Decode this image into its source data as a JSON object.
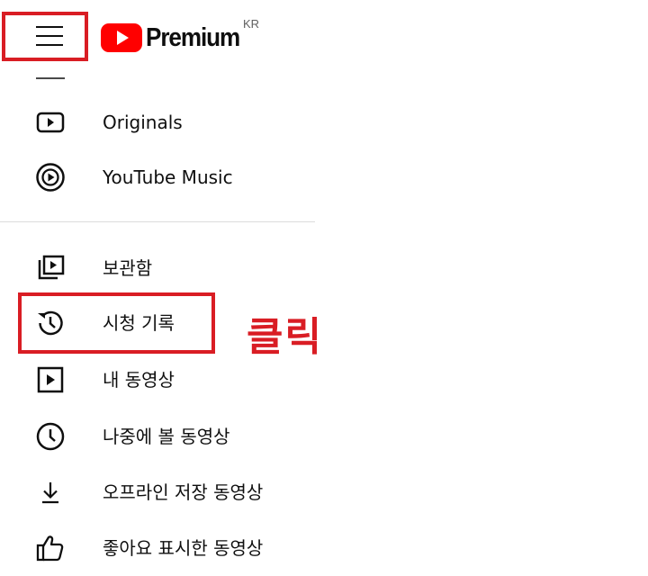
{
  "header": {
    "menu_icon": "hamburger-menu-icon",
    "logo_icon": "youtube-play-logo",
    "logo_text": "Premium",
    "country_code": "KR",
    "brand_color": "#ff0000"
  },
  "sidebar": {
    "items": [
      {
        "label": "Originals",
        "icon": "originals-icon"
      },
      {
        "label": "YouTube Music",
        "icon": "youtube-music-icon"
      },
      {
        "label": "보관함",
        "icon": "library-icon"
      },
      {
        "label": "시청 기록",
        "icon": "history-icon"
      },
      {
        "label": "내 동영상",
        "icon": "your-videos-icon"
      },
      {
        "label": "나중에 볼 동영상",
        "icon": "watch-later-icon"
      },
      {
        "label": "오프라인 저장 동영상",
        "icon": "download-icon"
      },
      {
        "label": "좋아요 표시한 동영상",
        "icon": "thumbs-up-icon"
      }
    ]
  },
  "annotation": {
    "text": "클릭",
    "color": "#d91d24"
  }
}
